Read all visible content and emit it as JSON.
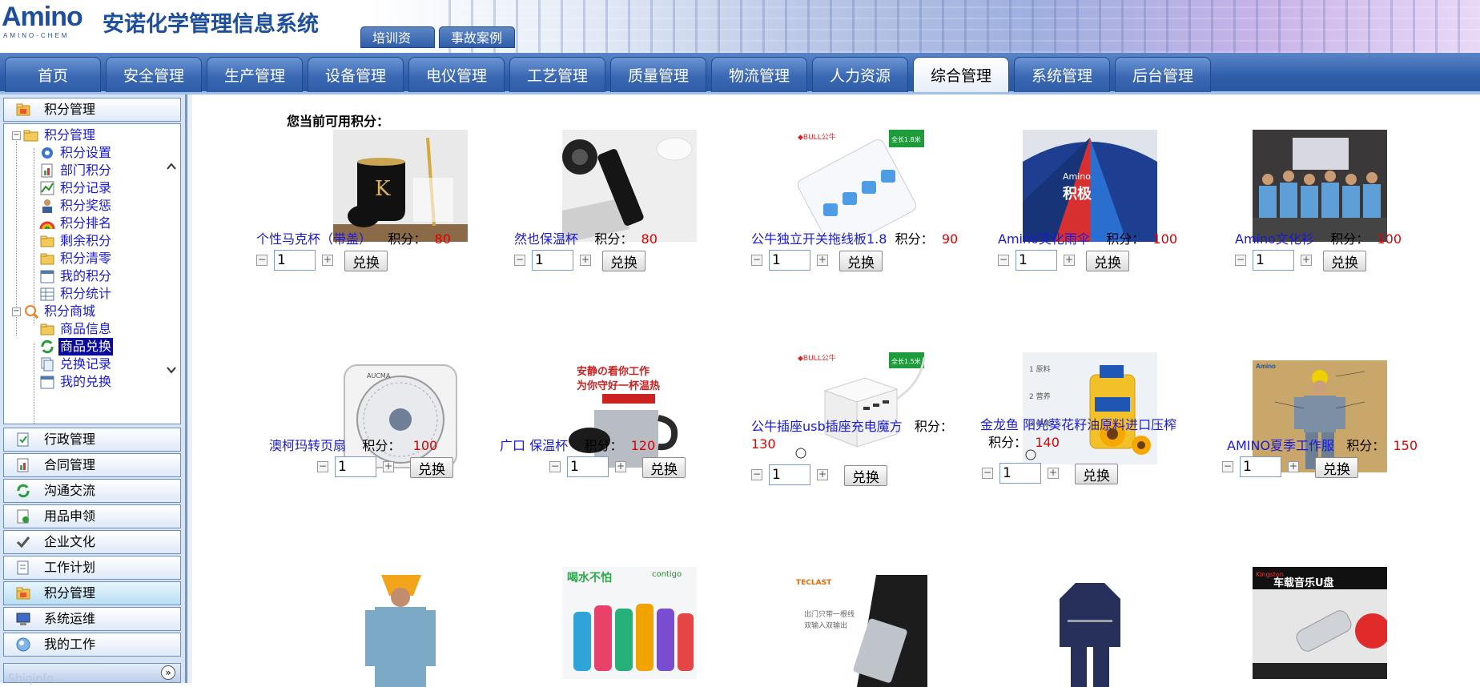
{
  "header": {
    "logo_text": "Amino",
    "logo_sub": "AMINO-CHEM",
    "app_title": "安诺化学管理信息系统",
    "top_tabs": [
      "培训资料",
      "事故案例"
    ]
  },
  "nav": {
    "tabs": [
      "首页",
      "安全管理",
      "生产管理",
      "设备管理",
      "电仪管理",
      "工艺管理",
      "质量管理",
      "物流管理",
      "人力资源",
      "综合管理",
      "系统管理",
      "后台管理"
    ],
    "active": "综合管理"
  },
  "sidebar": {
    "top_bar": "积分管理",
    "tree": {
      "group1": "积分管理",
      "group1_items": [
        "积分设置",
        "部门积分",
        "积分记录",
        "积分奖惩",
        "积分排名",
        "剩余积分",
        "积分清零",
        "我的积分",
        "积分统计"
      ],
      "group2": "积分商城",
      "group2_items": [
        "商品信息",
        "商品兑换",
        "兑换记录",
        "我的兑换"
      ],
      "selected": "商品兑换"
    },
    "bars": [
      "行政管理",
      "合同管理",
      "沟通交流",
      "用品申领",
      "企业文化",
      "工作计划",
      "积分管理",
      "系统运维",
      "我的工作"
    ],
    "highlighted_bar": "积分管理",
    "bottom_watermark": "Shiqinfo"
  },
  "content": {
    "points_label": "您当前可用积分：",
    "points_word": "积分：",
    "exchange_label": "兑换",
    "products": [
      {
        "name": "个性马克杯（带盖）",
        "points": "80",
        "qty": "1"
      },
      {
        "name": "然也保温杯",
        "points": "80",
        "qty": "1"
      },
      {
        "name": "公牛独立开关拖线板1.8",
        "points": "90",
        "qty": "1",
        "badge": "全长1.8米"
      },
      {
        "name": "Amino文化雨伞",
        "points": "100",
        "qty": "1"
      },
      {
        "name": "Amino文化衫",
        "points": "100",
        "qty": "1"
      },
      {
        "name": "澳柯玛转页扇",
        "points": "100",
        "qty": "1"
      },
      {
        "name": "广口 保温杯",
        "points": "120",
        "qty": "1",
        "img_text": "安静の看你工作\n为你守好一杯温热"
      },
      {
        "name": "公牛插座usb插座充电魔方",
        "points": "130",
        "qty": "1",
        "badge": "全长1.5米"
      },
      {
        "name": "金龙鱼 阳光葵花籽油原料进口压榨",
        "points": "140",
        "qty": "1"
      },
      {
        "name": "AMINO夏季工作服",
        "points": "150",
        "qty": "1"
      }
    ],
    "row3_imgs": [
      {
        "text": ""
      },
      {
        "text": "contigo"
      },
      {
        "text": "TECLAST"
      },
      {
        "text": ""
      },
      {
        "text": "车载音乐U盘"
      }
    ]
  }
}
